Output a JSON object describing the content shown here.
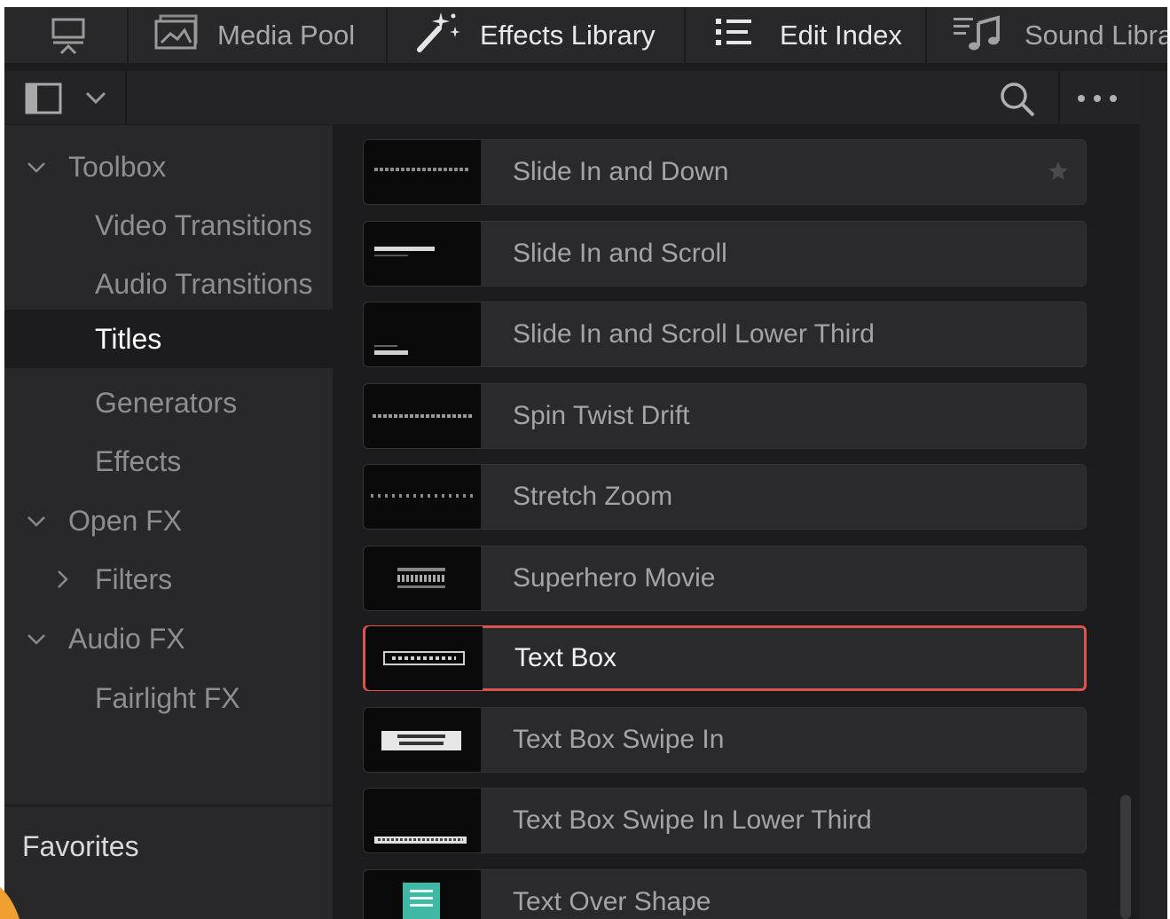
{
  "topbar": {
    "tabs": [
      {
        "label": "Media Pool",
        "icon": "media-pool-icon"
      },
      {
        "label": "Effects Library",
        "icon": "magic-wand-icon"
      },
      {
        "label": "Edit Index",
        "icon": "list-icon"
      },
      {
        "label": "Sound Libra",
        "icon": "sound-library-icon"
      }
    ],
    "first_icon": "monitor-icon"
  },
  "toolbar2": {
    "panel_toggle_icon": "sidebar-toggle-icon",
    "search_icon": "search-icon",
    "more_icon": "more-options-icon"
  },
  "sidebar": {
    "items": [
      {
        "label": "Toolbox",
        "chevron": "expanded"
      },
      {
        "label": "Video Transitions"
      },
      {
        "label": "Audio Transitions"
      },
      {
        "label": "Titles",
        "selected": true
      },
      {
        "label": "Generators"
      },
      {
        "label": "Effects"
      },
      {
        "label": "Open FX",
        "chevron": "expanded"
      },
      {
        "label": "Filters",
        "chevron": "collapsed"
      },
      {
        "label": "Audio FX",
        "chevron": "expanded"
      },
      {
        "label": "Fairlight FX"
      }
    ],
    "favorites_label": "Favorites"
  },
  "titles_list": {
    "items": [
      {
        "name": "Slide In and Down",
        "thumb_text": "SLIDE IN AND DOWN",
        "favorite_star": true
      },
      {
        "name": "Slide In and Scroll",
        "thumb_text": "SLIDE IN AND"
      },
      {
        "name": "Slide In and Scroll Lower Third",
        "thumb_text": ""
      },
      {
        "name": "Spin Twist Drift",
        "thumb_text": "SPIN TWIST DRIFT"
      },
      {
        "name": "Stretch Zoom",
        "thumb_text": "STRETCH ZOOM"
      },
      {
        "name": "Superhero Movie",
        "thumb_text": "SUPER HERO MOVIE"
      },
      {
        "name": "Text Box",
        "thumb_text": "TEXT BOX",
        "selected": true
      },
      {
        "name": "Text Box Swipe In",
        "thumb_text": "TEXT BOX SWIPE IN"
      },
      {
        "name": "Text Box Swipe In Lower Third",
        "thumb_text": ""
      },
      {
        "name": "Text Over Shape",
        "thumb_text": "TEXT OVER SHAPE"
      }
    ]
  },
  "colors": {
    "selection_outline": "#d9534f",
    "shape_thumb": "#3fb8a5",
    "accent": "#f0a030"
  }
}
